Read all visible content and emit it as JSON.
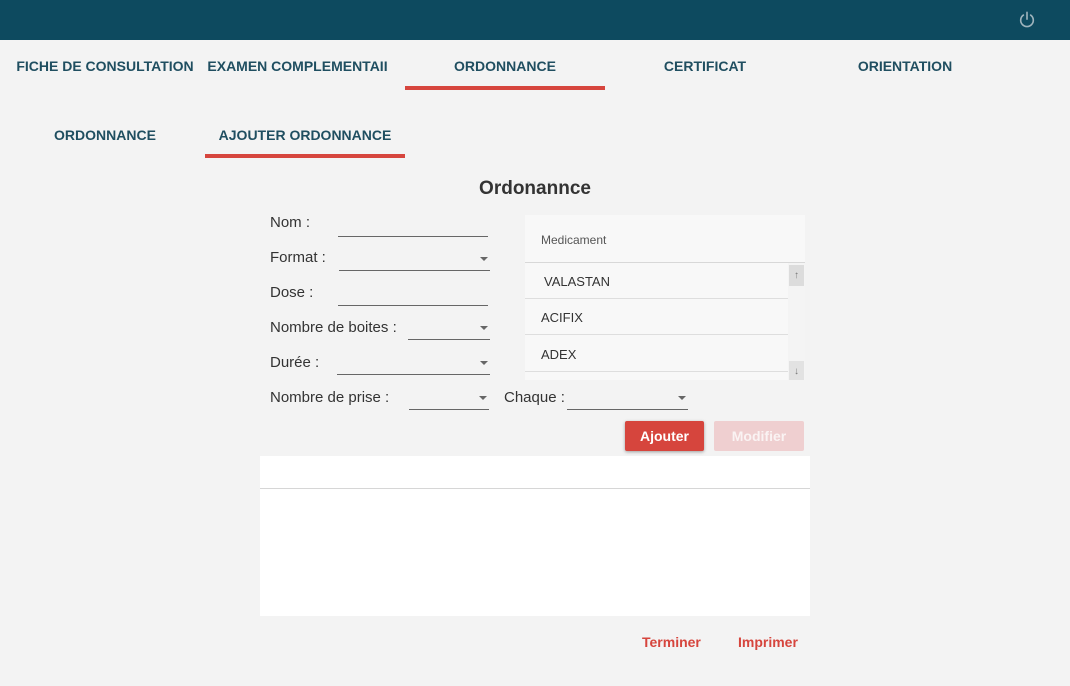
{
  "topbar": {
    "power_icon": "power-icon",
    "color": "#0d4a5f"
  },
  "main_tabs": [
    {
      "label": "FICHE DE CONSULTATION"
    },
    {
      "label": "EXAMEN COMPLEMENTAII"
    },
    {
      "label": "ORDONNANCE",
      "active": true
    },
    {
      "label": "CERTIFICAT"
    },
    {
      "label": "ORIENTATION"
    }
  ],
  "sub_tabs": [
    {
      "label": "ORDONNANCE"
    },
    {
      "label": "AJOUTER ORDONNANCE",
      "active": true
    }
  ],
  "form": {
    "title": "Ordonannce",
    "nom_label": "Nom :",
    "nom_value": "",
    "format_label": "Format :",
    "format_value": "",
    "dose_label": "Dose :",
    "dose_value": "",
    "boites_label": "Nombre de boites :",
    "boites_value": "",
    "duree_label": "Durée :",
    "duree_value": "",
    "prise_label": "Nombre de prise :",
    "prise_value": "",
    "chaque_label": "Chaque :",
    "chaque_value": ""
  },
  "medicaments": {
    "header": "Medicament",
    "items": [
      " VALASTAN",
      "ACIFIX",
      "ADEX"
    ]
  },
  "buttons": {
    "ajouter": "Ajouter",
    "modifier": "Modifier"
  },
  "footer": {
    "terminer": "Terminer",
    "imprimer": "Imprimer"
  },
  "colors": {
    "accent": "#d6453d",
    "tab_text": "#1f4e60",
    "disabled": "#efcfd0"
  }
}
